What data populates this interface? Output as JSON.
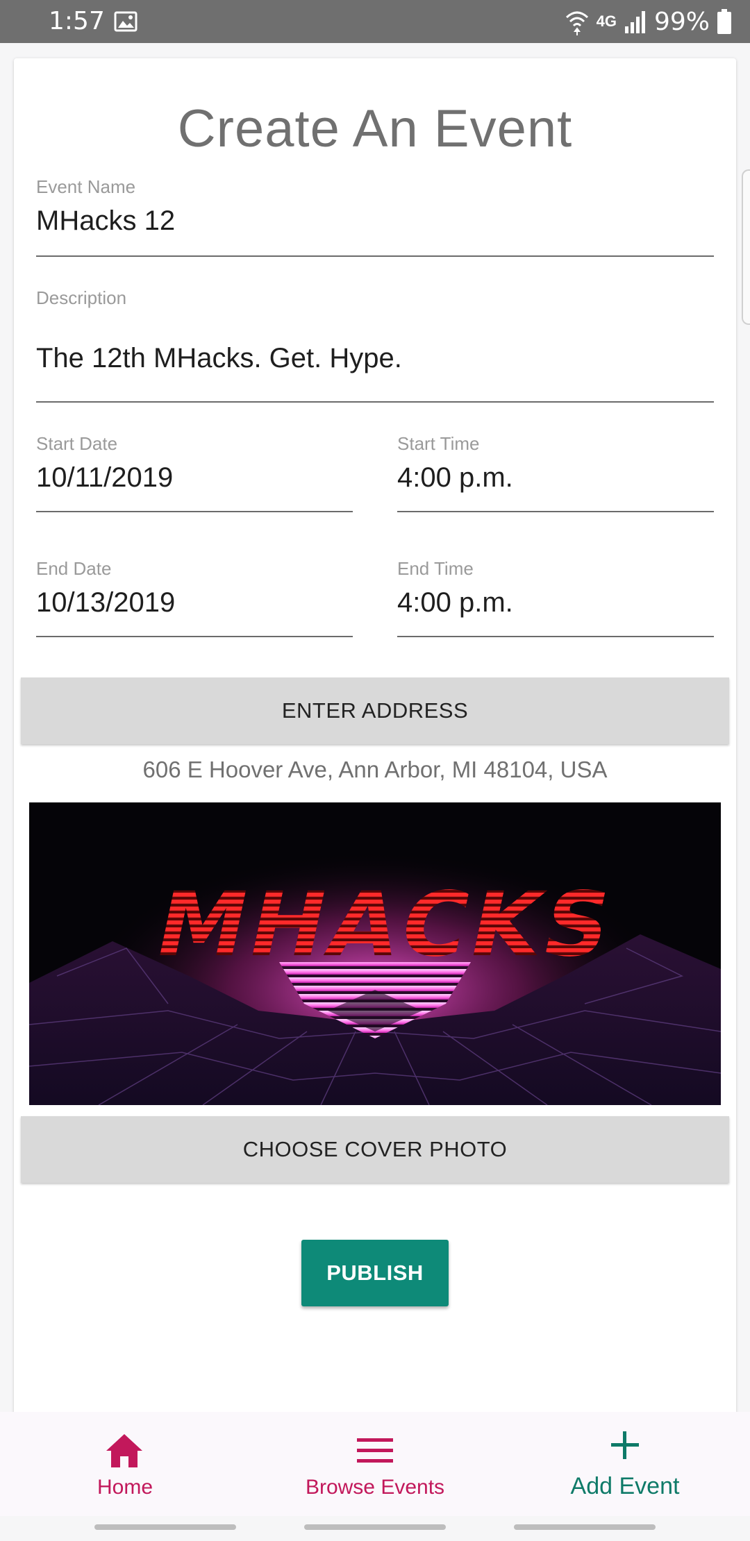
{
  "status_bar": {
    "time": "1:57",
    "network": "4G",
    "battery": "99%"
  },
  "form": {
    "title": "Create An Event",
    "event_name": {
      "label": "Event Name",
      "value": "MHacks 12"
    },
    "description": {
      "label": "Description",
      "value": "The 12th MHacks. Get. Hype."
    },
    "start_date": {
      "label": "Start Date",
      "value": "10/11/2019"
    },
    "start_time": {
      "label": "Start Time",
      "value": "4:00 p.m."
    },
    "end_date": {
      "label": "End Date",
      "value": "10/13/2019"
    },
    "end_time": {
      "label": "End Time",
      "value": "4:00 p.m."
    },
    "enter_address_label": "ENTER ADDRESS",
    "address": "606 E Hoover Ave, Ann Arbor, MI 48104, USA",
    "cover_image_text": "MHACKS",
    "choose_cover_label": "CHOOSE COVER PHOTO",
    "publish_label": "PUBLISH"
  },
  "bottom_nav": {
    "items": [
      {
        "label": "Home",
        "icon": "home-icon",
        "color": "#c2185b"
      },
      {
        "label": "Browse Events",
        "icon": "menu-icon",
        "color": "#c2185b"
      },
      {
        "label": "Add Event",
        "icon": "plus-icon",
        "color": "#0e7a68"
      }
    ]
  },
  "colors": {
    "accent_pink": "#c2185b",
    "accent_teal": "#0e8a78",
    "status_bar": "#6f6f6f"
  }
}
